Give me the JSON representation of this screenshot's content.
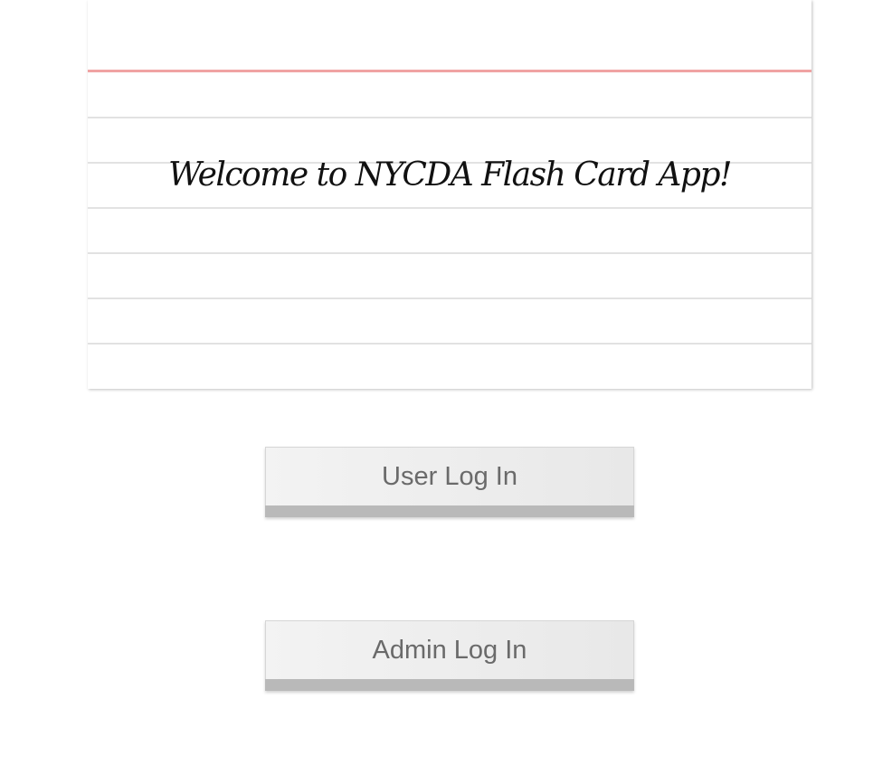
{
  "card": {
    "title": "Welcome to NYCDA Flash Card App!"
  },
  "buttons": {
    "user_login": "User Log In",
    "admin_login": "Admin Log In"
  },
  "colors": {
    "margin_line": "#f0a3a3",
    "rule_line": "#e2e2e2",
    "button_base": "#b9b9b9",
    "button_text": "#6a6a6a"
  }
}
